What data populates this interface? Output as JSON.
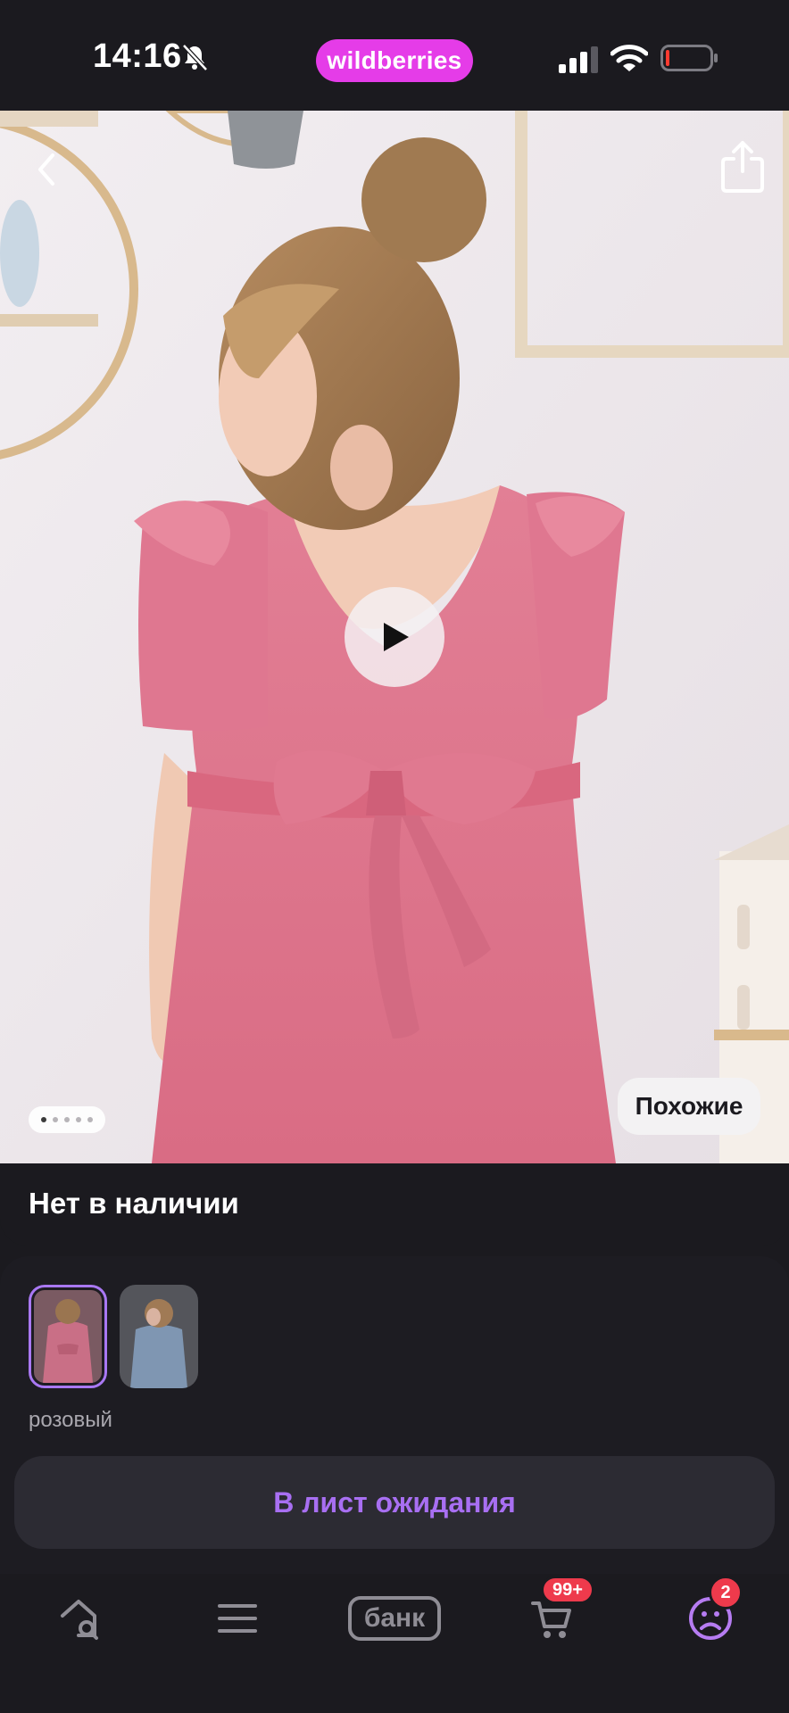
{
  "status_bar": {
    "time": "14:16",
    "brand": "wildberries",
    "icons": [
      "bell-slash-icon",
      "cellular-signal-icon",
      "wifi-icon",
      "battery-low-icon"
    ]
  },
  "hero": {
    "pager": {
      "total": 5,
      "active": 1
    },
    "similar_label": "Похожие"
  },
  "availability": {
    "label": "Нет в наличии"
  },
  "variants": {
    "color_label": "розовый",
    "thumbnails": [
      "pink-dress-thumbnail",
      "blue-dress-thumbnail"
    ]
  },
  "wait_button": {
    "label": "В лист ожидания"
  },
  "nav": {
    "bank_label": "банк",
    "cart_badge": "99+",
    "profile_badge": "2"
  },
  "colors": {
    "brand_pink": "#e53ce8",
    "accent_purple": "#a86ff2",
    "badge_red": "#ee3a4c",
    "background": "#1b1a1f"
  }
}
